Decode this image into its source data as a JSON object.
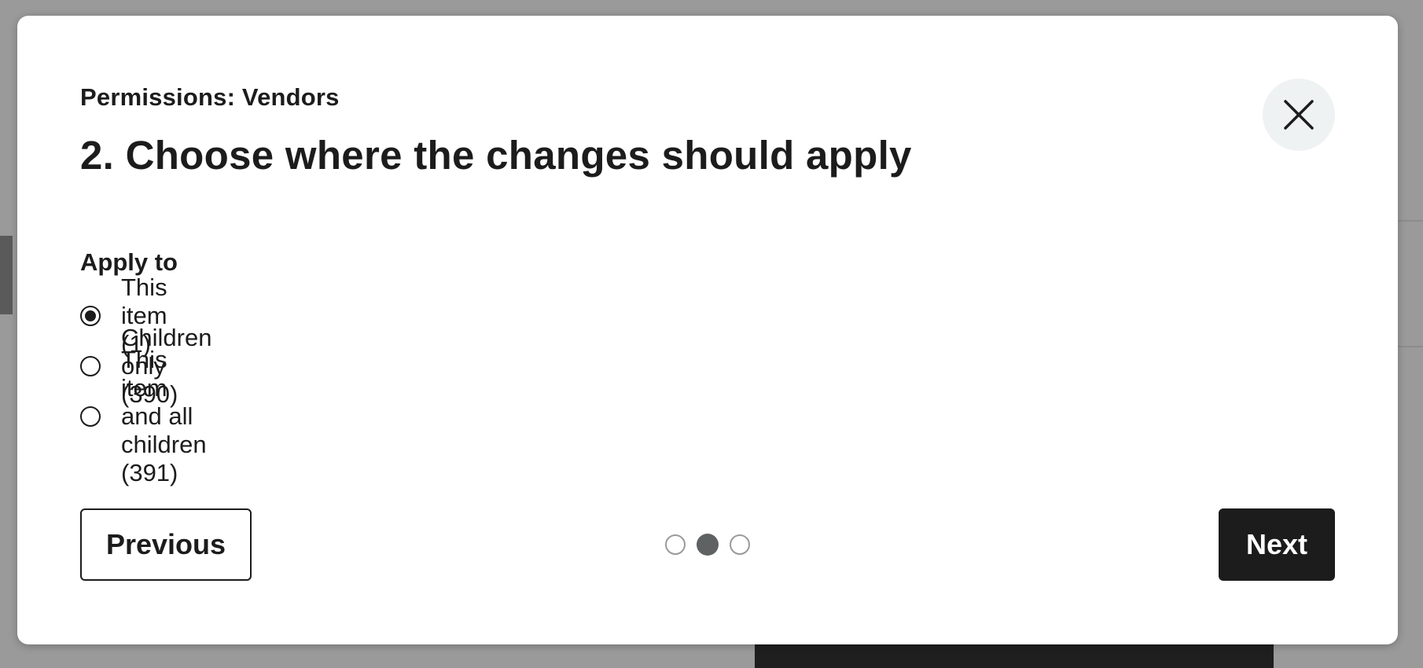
{
  "dialog": {
    "subtitle": "Permissions: Vendors",
    "title": "2. Choose where the changes should apply",
    "close_icon": "close-icon"
  },
  "apply_to": {
    "label": "Apply to",
    "options": [
      {
        "label": "This item (1)",
        "selected": true
      },
      {
        "label": "Children only (390)",
        "selected": false
      },
      {
        "label": "This item and all children (391)",
        "selected": false
      }
    ]
  },
  "footer": {
    "previous_label": "Previous",
    "next_label": "Next",
    "step_total": 3,
    "step_current": 2
  },
  "colors": {
    "text": "#1c1c1c",
    "primary_button": "#1c1c1c",
    "close_button_bg": "#eef2f2",
    "active_step": "#5f6263",
    "inactive_step_border": "#9a9a9a",
    "backdrop": "#9a9a9a"
  }
}
